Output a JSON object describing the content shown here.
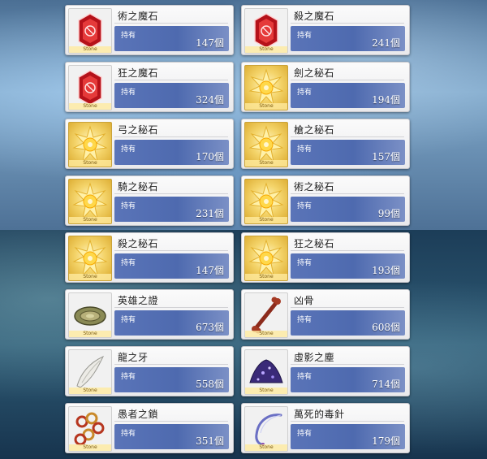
{
  "held_label": "持有",
  "unit": "個",
  "badge_text": "Stone",
  "colors": {
    "bar": "#5a74b8",
    "card": "#f4f4f6",
    "gold": "#f4d46a",
    "red_stone": "#c4161c"
  },
  "items": [
    {
      "name": "術之魔石",
      "count": "147",
      "icon": "red-magic-gem-icon"
    },
    {
      "name": "殺之魔石",
      "count": "241",
      "icon": "red-magic-gem-icon"
    },
    {
      "name": "狂之魔石",
      "count": "324",
      "icon": "red-magic-gem-icon"
    },
    {
      "name": "劍之秘石",
      "count": "194",
      "icon": "gold-secret-gem-icon"
    },
    {
      "name": "弓之秘石",
      "count": "170",
      "icon": "gold-secret-gem-icon"
    },
    {
      "name": "槍之秘石",
      "count": "157",
      "icon": "gold-secret-gem-icon"
    },
    {
      "name": "騎之秘石",
      "count": "231",
      "icon": "gold-secret-gem-icon"
    },
    {
      "name": "術之秘石",
      "count": "99",
      "icon": "gold-secret-gem-icon"
    },
    {
      "name": "殺之秘石",
      "count": "147",
      "icon": "gold-secret-gem-icon"
    },
    {
      "name": "狂之秘石",
      "count": "193",
      "icon": "gold-secret-gem-icon"
    },
    {
      "name": "英雄之證",
      "count": "673",
      "icon": "hero-proof-icon"
    },
    {
      "name": "凶骨",
      "count": "608",
      "icon": "bone-icon"
    },
    {
      "name": "龍之牙",
      "count": "558",
      "icon": "dragon-fang-icon"
    },
    {
      "name": "虛影之塵",
      "count": "714",
      "icon": "void-dust-icon"
    },
    {
      "name": "愚者之鎖",
      "count": "351",
      "icon": "fools-chain-icon"
    },
    {
      "name": "萬死的毒針",
      "count": "179",
      "icon": "poison-needle-icon"
    }
  ]
}
